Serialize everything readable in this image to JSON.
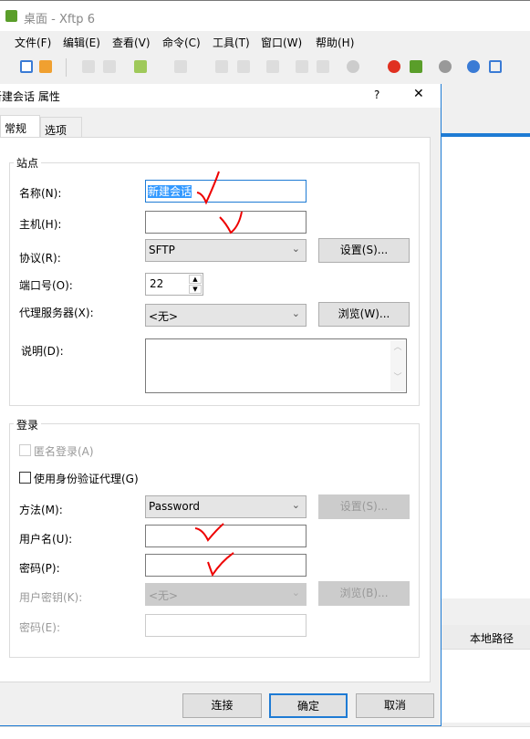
{
  "app": {
    "title": "桌面 - Xftp 6"
  },
  "menu": [
    "文件(F)",
    "编辑(E)",
    "查看(V)",
    "命令(C)",
    "工具(T)",
    "窗口(W)",
    "帮助(H)"
  ],
  "dialog": {
    "title": "新建会话 属性",
    "help": "?",
    "close": "✕",
    "tabs": [
      "常规",
      "选项"
    ],
    "site": {
      "group": "站点",
      "name_label": "名称(N):",
      "name_value": "新建会话",
      "host_label": "主机(H):",
      "host_value": "",
      "protocol_label": "协议(R):",
      "protocol_value": "SFTP",
      "settings_btn": "设置(S)...",
      "port_label": "端口号(O):",
      "port_value": "22",
      "proxy_label": "代理服务器(X):",
      "proxy_value": "<无>",
      "browse_btn": "浏览(W)...",
      "desc_label": "说明(D):",
      "desc_value": ""
    },
    "login": {
      "group": "登录",
      "anonymous": "匿名登录(A)",
      "auth_agent": "使用身份验证代理(G)",
      "method_label": "方法(M):",
      "method_value": "Password",
      "settings_btn": "设置(S)...",
      "user_label": "用户名(U):",
      "user_value": "",
      "pwd_label": "密码(P):",
      "pwd_value": "",
      "key_label": "用户密钥(K):",
      "key_value": "<无>",
      "key_browse_btn": "浏览(B)...",
      "passphrase_label": "密码(E):",
      "passphrase_value": ""
    },
    "buttons": {
      "connect": "连接",
      "ok": "确定",
      "cancel": "取消"
    }
  },
  "background": {
    "column_header": "本地路径"
  },
  "colors": {
    "accent": "#1e7bd4",
    "annotation": "#e00000"
  }
}
